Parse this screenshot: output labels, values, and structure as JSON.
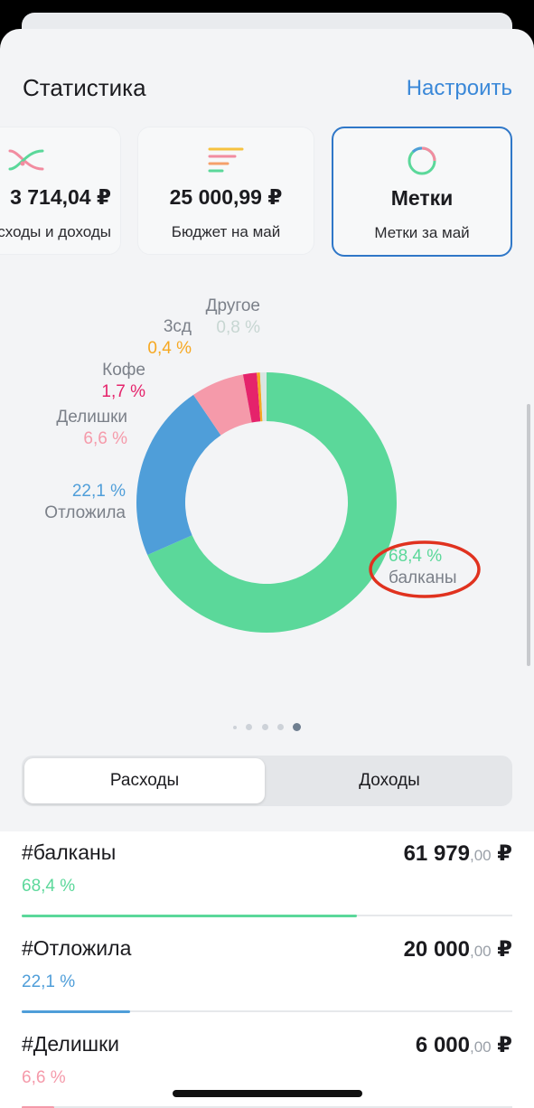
{
  "header": {
    "title": "Статистика",
    "action_label": "Настроить"
  },
  "cards": [
    {
      "amount": "3 714,04 ₽",
      "subtitle": "Расходы и доходы",
      "icon": "flow-chart-icon",
      "selected": false
    },
    {
      "amount": "25 000,99 ₽",
      "subtitle": "Бюджет на май",
      "icon": "budget-lines-icon",
      "selected": false
    },
    {
      "amount": "Метки",
      "subtitle": "Метки за май",
      "icon": "ring-chart-icon",
      "selected": true
    }
  ],
  "chart_data": {
    "type": "pie",
    "style": "donut",
    "slices": [
      {
        "name": "балканы",
        "value": 68.4,
        "label": "68,4 %",
        "color": "#5bd89a"
      },
      {
        "name": "Отложила",
        "value": 22.1,
        "label": "22,1 %",
        "color": "#4f9ed9"
      },
      {
        "name": "Делишки",
        "value": 6.6,
        "label": "6,6 %",
        "color": "#f59aaa"
      },
      {
        "name": "Кофе",
        "value": 1.7,
        "label": "1,7 %",
        "color": "#e5236b"
      },
      {
        "name": "3сд",
        "value": 0.4,
        "label": "0,4 %",
        "color": "#f6a821"
      },
      {
        "name": "Другое",
        "value": 0.8,
        "label": "0,8 %",
        "color": "#d9e6e2"
      }
    ],
    "highlight": "балканы"
  },
  "colors": {
    "accent": "#3a88d8",
    "highlight_ring": "#e0321f"
  },
  "pager": {
    "count": 5,
    "active": 4
  },
  "segmented": {
    "left_label": "Расходы",
    "right_label": "Доходы",
    "selected": "Расходы"
  },
  "list": [
    {
      "tag": "#балканы",
      "percent": "68,4 %",
      "amount_main": "61 979",
      "amount_kop": ",00",
      "currency": "₽",
      "ratio": 0.684,
      "color": "#5bd89a"
    },
    {
      "tag": "#Отложила",
      "percent": "22,1 %",
      "amount_main": "20 000",
      "amount_kop": ",00",
      "currency": "₽",
      "ratio": 0.221,
      "color": "#4f9ed9"
    },
    {
      "tag": "#Делишки",
      "percent": "6,6 %",
      "amount_main": "6 000",
      "amount_kop": ",00",
      "currency": "₽",
      "ratio": 0.066,
      "color": "#f59aaa"
    }
  ]
}
